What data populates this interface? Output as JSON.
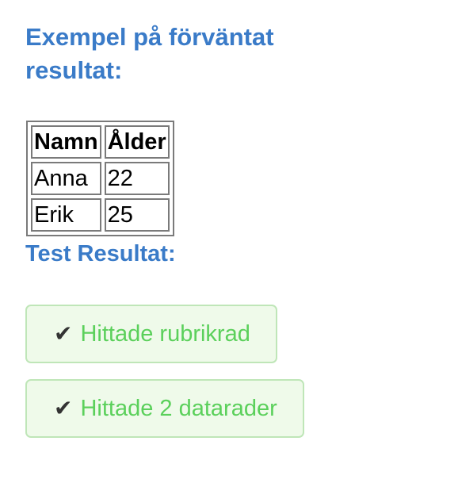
{
  "heading": "Exempel på förväntat resultat:",
  "table": {
    "headers": [
      "Namn",
      "Ålder"
    ],
    "rows": [
      [
        "Anna",
        "22"
      ],
      [
        "Erik",
        "25"
      ]
    ]
  },
  "test_heading": "Test Resultat:",
  "results": [
    {
      "icon": "✔",
      "text": "Hittade rubrikrad"
    },
    {
      "icon": "✔",
      "text": "Hittade 2 datarader"
    }
  ],
  "colors": {
    "heading": "#3a7bc8",
    "success_text": "#5bd05b",
    "success_bg": "#effaea",
    "success_border": "#bfe6b8"
  }
}
